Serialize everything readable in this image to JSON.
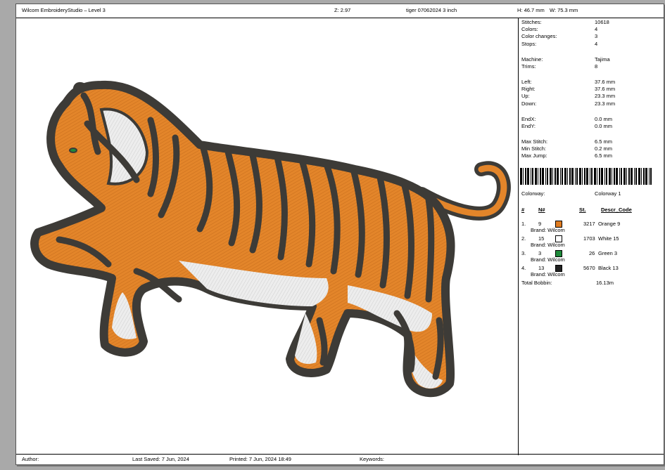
{
  "header": {
    "app_title": "Wilcom EmbroideryStudio – Level 3",
    "zoom": "Z: 2.97",
    "file_name": "tiger 07062024 3 inch",
    "height": "H: 46.7 mm",
    "width": "W: 75.3 mm"
  },
  "stats": [
    {
      "label": "Stitches:",
      "value": "10618"
    },
    {
      "label": "Colors:",
      "value": "4"
    },
    {
      "label": "Color changes:",
      "value": "3"
    },
    {
      "label": "Stops:",
      "value": "4"
    },
    {
      "label": "Machine:",
      "value": "Tajima"
    },
    {
      "label": "Trims:",
      "value": "8"
    },
    {
      "label": "Left:",
      "value": "37.6 mm"
    },
    {
      "label": "Right:",
      "value": "37.6 mm"
    },
    {
      "label": "Up:",
      "value": "23.3 mm"
    },
    {
      "label": "Down:",
      "value": "23.3 mm"
    },
    {
      "label": "EndX:",
      "value": "0.0 mm"
    },
    {
      "label": "EndY:",
      "value": "0.0 mm"
    },
    {
      "label": "Max Stitch:",
      "value": "6.5 mm"
    },
    {
      "label": "Min Stitch:",
      "value": "0.2 mm"
    },
    {
      "label": "Max Jump:",
      "value": "6.5 mm"
    }
  ],
  "colorway": {
    "label": "Colorway:",
    "value": "Colorway 1"
  },
  "table": {
    "headers": {
      "num": "#",
      "n": "N#",
      "st": "St.",
      "descr": "Descr_Code"
    },
    "rows": [
      {
        "idx": "1.",
        "n": "9",
        "color": "#e07b1f",
        "st": "3217",
        "descr": "Orange 9",
        "brand": "Brand: Wilcom"
      },
      {
        "idx": "2.",
        "n": "15",
        "color": "#ffffff",
        "st": "1703",
        "descr": "White 15",
        "brand": "Brand: Wilcom"
      },
      {
        "idx": "3.",
        "n": "3",
        "color": "#1e8a3a",
        "st": "26",
        "descr": "Green 3",
        "brand": "Brand: Wilcom"
      },
      {
        "idx": "4.",
        "n": "13",
        "color": "#222222",
        "st": "5670",
        "descr": "Black 13",
        "brand": "Brand: Wilcom"
      }
    ],
    "total_label": "Total Bobbin:",
    "total_value": "16.13m"
  },
  "footer": {
    "author": "Author:",
    "last_saved": "Last Saved:  7 Jun, 2024",
    "printed": "Printed:  7 Jun, 2024 18:49",
    "keywords": "Keywords:"
  },
  "colors": {
    "orange": "#e3852a",
    "outline": "#3d3b37",
    "white_fill": "#ececec",
    "eye_green": "#1e8a3a"
  }
}
